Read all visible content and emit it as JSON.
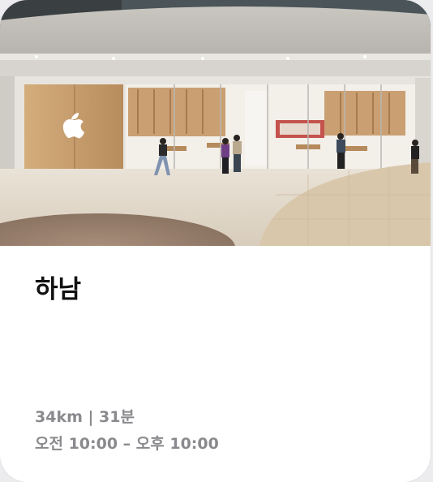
{
  "store": {
    "name": "하남",
    "distance_time": "34km | 31분",
    "hours": "오전 10:00 – 오후 10:00"
  },
  "colors": {
    "card_background": "#ffffff",
    "title_text": "#111111",
    "secondary_text": "#8a8a8e"
  },
  "icons": {
    "brand_logo": "apple-logo-icon"
  }
}
